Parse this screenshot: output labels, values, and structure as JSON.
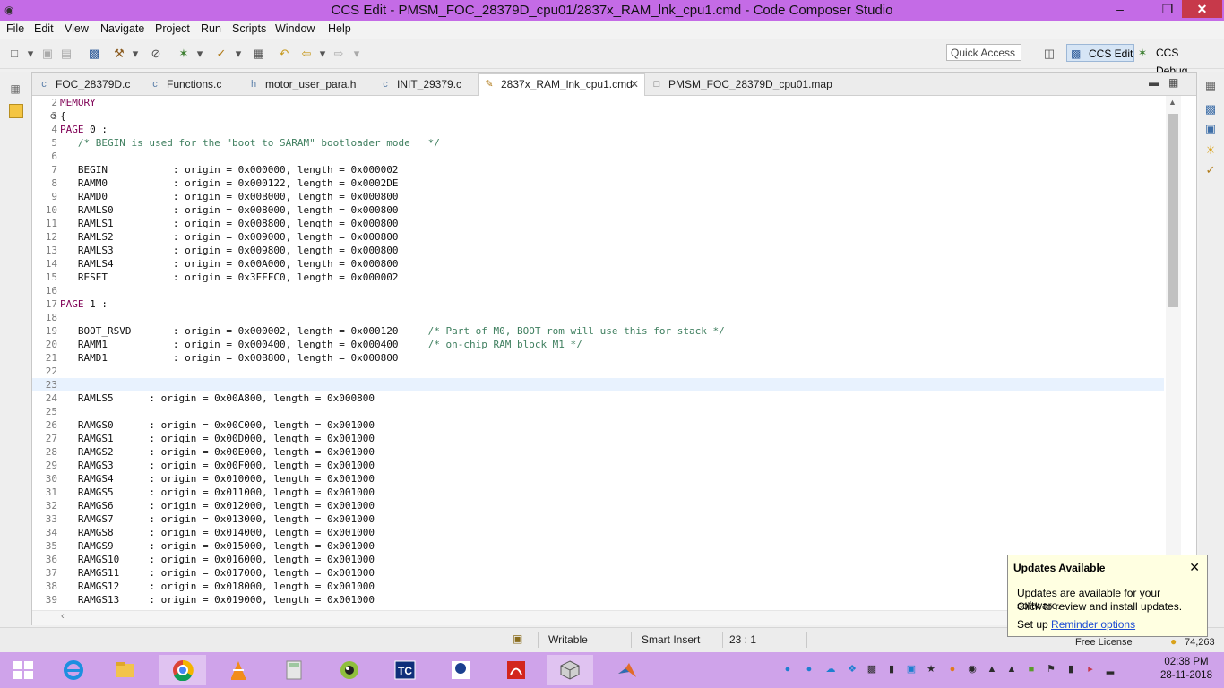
{
  "window": {
    "title": "CCS Edit - PMSM_FOC_28379D_cpu01/2837x_RAM_lnk_cpu1.cmd - Code Composer Studio",
    "minimize": "–",
    "maximize": "❐",
    "close": "✕"
  },
  "menu": [
    "File",
    "Edit",
    "View",
    "Navigate",
    "Project",
    "Run",
    "Scripts",
    "Window",
    "Help"
  ],
  "toolbar": {
    "quick_access_placeholder": "Quick Access",
    "perspective_edit": "CCS Edit",
    "perspective_debug": "CCS Debug"
  },
  "tabs": [
    {
      "label": "FOC_28379D.c",
      "icon": "c-file-icon"
    },
    {
      "label": "Functions.c",
      "icon": "c-file-icon"
    },
    {
      "label": "motor_user_para.h",
      "icon": "h-file-icon"
    },
    {
      "label": "INIT_29379.c",
      "icon": "c-file-icon"
    },
    {
      "label": "2837x_RAM_lnk_cpu1.cmd",
      "icon": "cmd-file-icon",
      "active": true,
      "close": "✕"
    },
    {
      "label": "PMSM_FOC_28379D_cpu01.map",
      "icon": "map-file-icon"
    }
  ],
  "code_lines": [
    {
      "n": "2",
      "t": "MEMORY",
      "kind": "kw"
    },
    {
      "n": "3",
      "t": "{",
      "fold": "⊖"
    },
    {
      "n": "4",
      "t": "PAGE 0 :",
      "kind": "page"
    },
    {
      "n": "5",
      "t": "   /* BEGIN is used for the \"boot to SARAM\" bootloader mode   */",
      "kind": "cm"
    },
    {
      "n": "6",
      "t": ""
    },
    {
      "n": "7",
      "t": "   BEGIN           : origin = 0x000000, length = 0x000002"
    },
    {
      "n": "8",
      "t": "   RAMM0           : origin = 0x000122, length = 0x0002DE"
    },
    {
      "n": "9",
      "t": "   RAMD0           : origin = 0x00B000, length = 0x000800"
    },
    {
      "n": "10",
      "t": "   RAMLS0          : origin = 0x008000, length = 0x000800"
    },
    {
      "n": "11",
      "t": "   RAMLS1          : origin = 0x008800, length = 0x000800"
    },
    {
      "n": "12",
      "t": "   RAMLS2          : origin = 0x009000, length = 0x000800"
    },
    {
      "n": "13",
      "t": "   RAMLS3          : origin = 0x009800, length = 0x000800"
    },
    {
      "n": "14",
      "t": "   RAMLS4          : origin = 0x00A000, length = 0x000800"
    },
    {
      "n": "15",
      "t": "   RESET           : origin = 0x3FFFC0, length = 0x000002"
    },
    {
      "n": "16",
      "t": ""
    },
    {
      "n": "17",
      "t": "PAGE 1 :",
      "kind": "page"
    },
    {
      "n": "18",
      "t": ""
    },
    {
      "n": "19",
      "t": "   BOOT_RSVD       : origin = 0x000002, length = 0x000120     /* Part of M0, BOOT rom will use this for stack */",
      "comment_at": 62
    },
    {
      "n": "20",
      "t": "   RAMM1           : origin = 0x000400, length = 0x000400     /* on-chip RAM block M1 */",
      "comment_at": 62
    },
    {
      "n": "21",
      "t": "   RAMD1           : origin = 0x00B800, length = 0x000800"
    },
    {
      "n": "22",
      "t": ""
    },
    {
      "n": "23",
      "t": "",
      "current": true
    },
    {
      "n": "24",
      "t": "   RAMLS5      : origin = 0x00A800, length = 0x000800"
    },
    {
      "n": "25",
      "t": ""
    },
    {
      "n": "26",
      "t": "   RAMGS0      : origin = 0x00C000, length = 0x001000"
    },
    {
      "n": "27",
      "t": "   RAMGS1      : origin = 0x00D000, length = 0x001000"
    },
    {
      "n": "28",
      "t": "   RAMGS2      : origin = 0x00E000, length = 0x001000"
    },
    {
      "n": "29",
      "t": "   RAMGS3      : origin = 0x00F000, length = 0x001000"
    },
    {
      "n": "30",
      "t": "   RAMGS4      : origin = 0x010000, length = 0x001000"
    },
    {
      "n": "31",
      "t": "   RAMGS5      : origin = 0x011000, length = 0x001000"
    },
    {
      "n": "32",
      "t": "   RAMGS6      : origin = 0x012000, length = 0x001000"
    },
    {
      "n": "33",
      "t": "   RAMGS7      : origin = 0x013000, length = 0x001000"
    },
    {
      "n": "34",
      "t": "   RAMGS8      : origin = 0x014000, length = 0x001000"
    },
    {
      "n": "35",
      "t": "   RAMGS9      : origin = 0x015000, length = 0x001000"
    },
    {
      "n": "36",
      "t": "   RAMGS10     : origin = 0x016000, length = 0x001000"
    },
    {
      "n": "37",
      "t": "   RAMGS11     : origin = 0x017000, length = 0x001000"
    },
    {
      "n": "38",
      "t": "   RAMGS12     : origin = 0x018000, length = 0x001000"
    },
    {
      "n": "39",
      "t": "   RAMGS13     : origin = 0x019000, length = 0x001000"
    }
  ],
  "status": {
    "writable": "Writable",
    "insert_mode": "Smart Insert",
    "position": "23 : 1",
    "license": "Free License",
    "memory": "74,263"
  },
  "notification": {
    "title": "Updates Available",
    "body_line1": "Updates are available for your software.",
    "body_line2": "Click to review and install updates.",
    "setup_prefix": "Set up ",
    "setup_link": "Reminder options",
    "close": "✕"
  },
  "taskbar": {
    "apps": [
      "start",
      "internet-explorer",
      "file-explorer",
      "chrome",
      "vlc",
      "calculator",
      "webcam-app",
      "turbo-c",
      "iit-app",
      "acrobat",
      "code-composer-studio",
      "matlab"
    ],
    "time": "02:38 PM",
    "date": "28-11-2018"
  },
  "colors": {
    "title_bar": "#c46be6",
    "taskbar": "#cfa3ea",
    "keyword": "#7f0055",
    "comment": "#3f7f5f",
    "current_line": "#e8f2fe",
    "close_button": "#c7394a"
  }
}
